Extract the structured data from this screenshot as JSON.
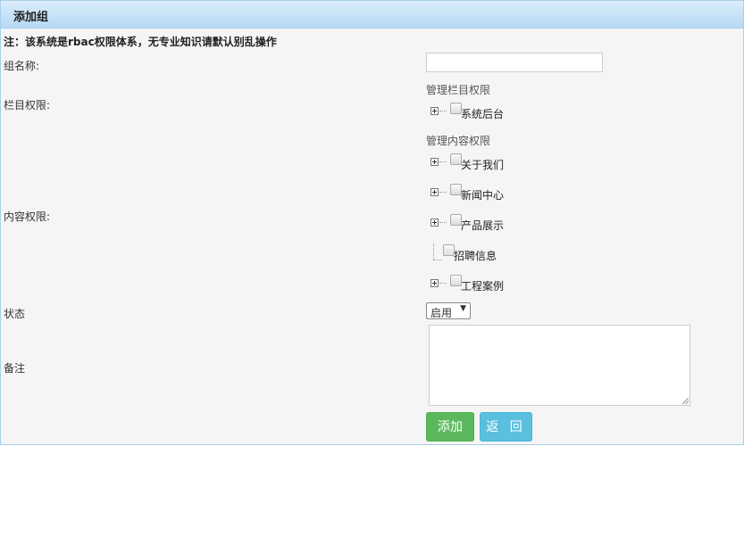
{
  "panel": {
    "title": "添加组"
  },
  "notice": "注：该系统是rbac权限体系，无专业知识请默认别乱操作",
  "form": {
    "group_name_label": "组名称:",
    "group_name_value": "",
    "column_perm_label": "栏目权限:",
    "content_perm_label": "内容权限:",
    "status_label": "状态",
    "status_value": "启用",
    "remark_label": "备注",
    "remark_value": ""
  },
  "column_tree": {
    "title": "管理栏目权限",
    "items": [
      {
        "label": "系统后台",
        "expandable": true,
        "checked": false
      }
    ]
  },
  "content_tree": {
    "title": "管理内容权限",
    "items": [
      {
        "label": "关于我们",
        "expandable": true,
        "checked": false
      },
      {
        "label": "新闻中心",
        "expandable": true,
        "checked": false
      },
      {
        "label": "产品展示",
        "expandable": true,
        "checked": false
      },
      {
        "label": "招聘信息",
        "expandable": false,
        "checked": false
      },
      {
        "label": "工程案例",
        "expandable": true,
        "checked": false
      }
    ]
  },
  "buttons": {
    "add": "添加",
    "back": "返 回"
  },
  "colors": {
    "add_button": "#5cb85c",
    "back_button": "#5bc0de",
    "header_gradient_top": "#dcedfa",
    "header_gradient_bottom": "#b6daf6"
  },
  "icons": {
    "expander": "plus-square-icon"
  }
}
